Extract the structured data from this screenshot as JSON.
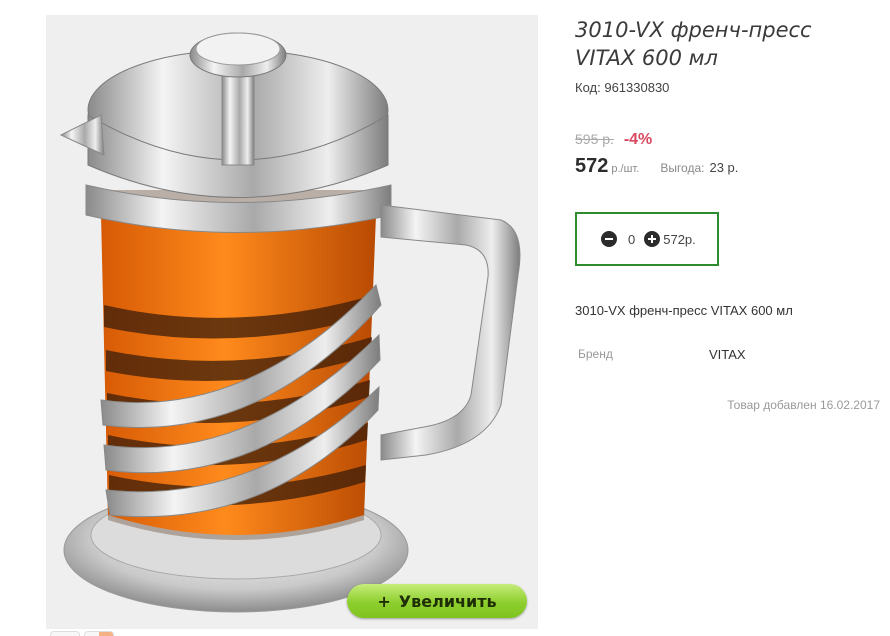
{
  "product": {
    "title": "3010-VX френч-пресс VITAX 600 мл",
    "code_label": "Код:",
    "code": "961330830",
    "old_price": "595 р.",
    "discount": "-4%",
    "price": "572",
    "price_unit": "р./шт.",
    "benefit_label": "Выгода:",
    "benefit_value": "23 р.",
    "short_description": "3010-VX френч-пресс VITAX 600 мл",
    "brand_label": "Бренд",
    "brand_value": "VITAX",
    "added_text": "Товар добавлен 16.02.2017"
  },
  "cart": {
    "minus_icon": "minus-circle-icon",
    "quantity": "0",
    "plus_icon": "plus-circle-icon",
    "sum": "572р."
  },
  "image": {
    "zoom_label": "Увеличить",
    "zoom_icon_glyph": "+",
    "liquid_color": "#f07a10",
    "steel_color": "#c8c8c8"
  }
}
